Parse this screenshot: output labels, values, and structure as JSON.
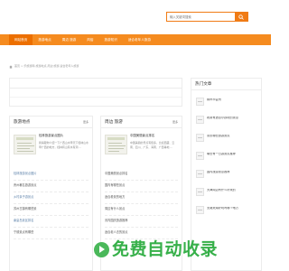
{
  "search": {
    "placeholder": "输入关键词搜索"
  },
  "nav": {
    "items": [
      {
        "label": "网站首页",
        "active": true
      },
      {
        "label": "旅游地点",
        "active": false
      },
      {
        "label": "周边 旅游",
        "active": false
      },
      {
        "label": "风俗",
        "active": false
      },
      {
        "label": "旅游知识",
        "active": false
      },
      {
        "label": "适合老年人旅游",
        "active": false
      }
    ]
  },
  "breadcrumb": {
    "text": "首页 > 乐旅游网-旅游地点,周边 旅游,适合老年人旅游"
  },
  "hot_articles": {
    "title": "热门文章",
    "items": [
      "柳州市会所",
      "看到有适合小孩玩的景点",
      "重庆哪些旅游景点",
      "哪些有一日游景点推荐",
      "国内旅游景点推荐",
      "天津周边有什么好玩的",
      "无锡太湖好玩吗哪个地方"
    ]
  },
  "left_panel": {
    "title": "旅游地点",
    "more": "更多",
    "featured": {
      "title": "桂林旅游景点图片",
      "summary": "我得跟你介绍一下广西山水甲天下桂林山水甲广西的地方，桂林有山有水有洞 ..."
    },
    "items": [
      "桂林旅游景点图片",
      "贵州著名旅游景点",
      "乡村亲子游景点",
      "苏州古镇有哪些景",
      "秦皇岛景区排名",
      "宁德景点有哪些"
    ]
  },
  "mid_panel": {
    "title": "周边 旅游",
    "more": "更多",
    "featured": {
      "title": "中国美丽景点排名",
      "summary": "中国美丽的景点有很多，比如西藏、云南、四川、广东、海南、广西等地 ..."
    },
    "items": [
      "中国美丽景点排名",
      "国内有哪些景点",
      "适合看景的地方",
      "周边有什么景点",
      "省内国庆旅游推荐",
      "适合老人去的景点"
    ]
  },
  "watermark": {
    "text": "免费自动收录"
  }
}
